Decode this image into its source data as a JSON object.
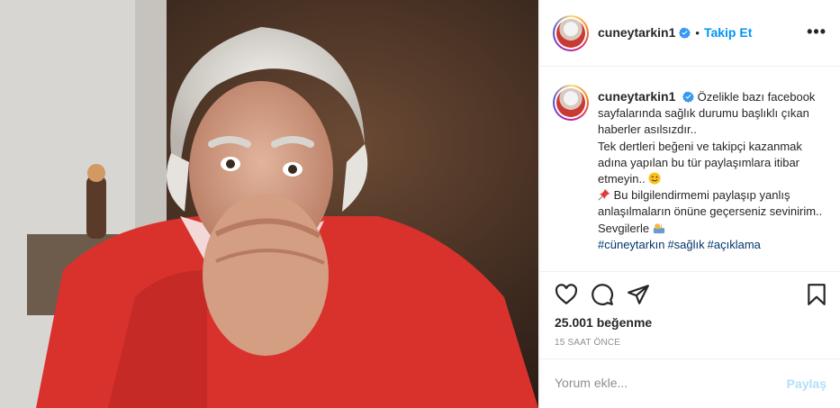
{
  "post": {
    "image_description_icon": "portrait-photo",
    "author": {
      "username": "cuneytarkin1",
      "verified": true,
      "follow_label": "Takip Et",
      "separator": "•"
    },
    "more_label": "•••",
    "caption": {
      "line1": "Özelikle bazı facebook sayfalarında sağlık durumu başlıklı çıkan haberler asılsızdır..",
      "line2": "Tek dertleri beğeni ve takipçi kazanmak adına yapılan bu tür paylaşımlara itibar etmeyin..",
      "line3": "Bu bilgilendirmemi paylaşıp yanlış anlaşılmaların önüne geçerseniz sevinirim..",
      "line4": "Sevgilerle",
      "hashtags": [
        "#cüneytarkın",
        "#sağlık",
        "#açıklama"
      ],
      "emoji_wink": "wink-emoji",
      "emoji_pin": "pushpin-emoji",
      "emoji_wave": "waving-hand-emoji"
    },
    "likes": "25.001 beğenme",
    "time": "15 SAAT ÖNCE",
    "comment": {
      "placeholder": "Yorum ekle...",
      "value": "",
      "share_label": "Paylaş"
    },
    "colors": {
      "accent": "#0095f6",
      "share_disabled": "#b2dffc",
      "hashtag": "#00376b",
      "muted": "#8e8e8e"
    }
  }
}
